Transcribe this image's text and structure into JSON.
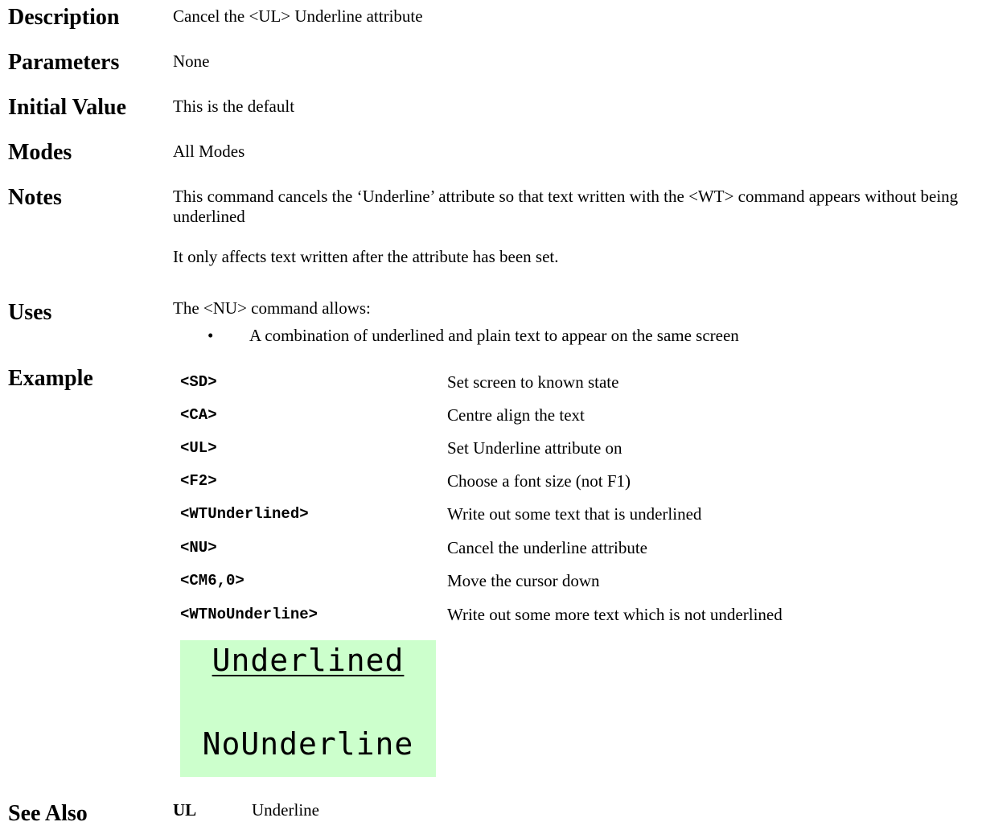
{
  "sections": {
    "description": {
      "label": "Description",
      "text": "Cancel the <UL> Underline attribute"
    },
    "parameters": {
      "label": "Parameters",
      "text": "None"
    },
    "initial_value": {
      "label": "Initial Value",
      "text": "This is the default"
    },
    "modes": {
      "label": "Modes",
      "text": "All Modes"
    },
    "notes": {
      "label": "Notes",
      "paragraph1": "This command cancels the ‘Underline’ attribute so that text written with the <WT> command appears without being underlined",
      "paragraph2": "It only affects text written after the attribute has been set."
    },
    "uses": {
      "label": "Uses",
      "intro": "The <NU> command allows:",
      "bullet_symbol": "•",
      "bullets": [
        "A combination of underlined and plain text to appear on the same screen"
      ]
    },
    "example": {
      "label": "Example",
      "rows": [
        {
          "command": "<SD>",
          "description": "Set screen to known state"
        },
        {
          "command": "<CA>",
          "description": "Centre align the text"
        },
        {
          "command": "<UL>",
          "description": "Set Underline attribute on"
        },
        {
          "command": "<F2>",
          "description": "Choose a font size (not F1)"
        },
        {
          "command": "<WTUnderlined>",
          "description": "Write out some text that is underlined"
        },
        {
          "command": "<NU>",
          "description": "Cancel the underline attribute"
        },
        {
          "command": "<CM6,0>",
          "description": "Move the cursor down"
        },
        {
          "command": "<WTNoUnderline>",
          "description": "Write out some more text which is not underlined"
        }
      ],
      "lcd": {
        "background": "#ccffcc",
        "line1": "Underlined",
        "line2": "NoUnderline"
      }
    },
    "see_also": {
      "label": "See Also",
      "code": "UL",
      "description": "Underline"
    }
  }
}
